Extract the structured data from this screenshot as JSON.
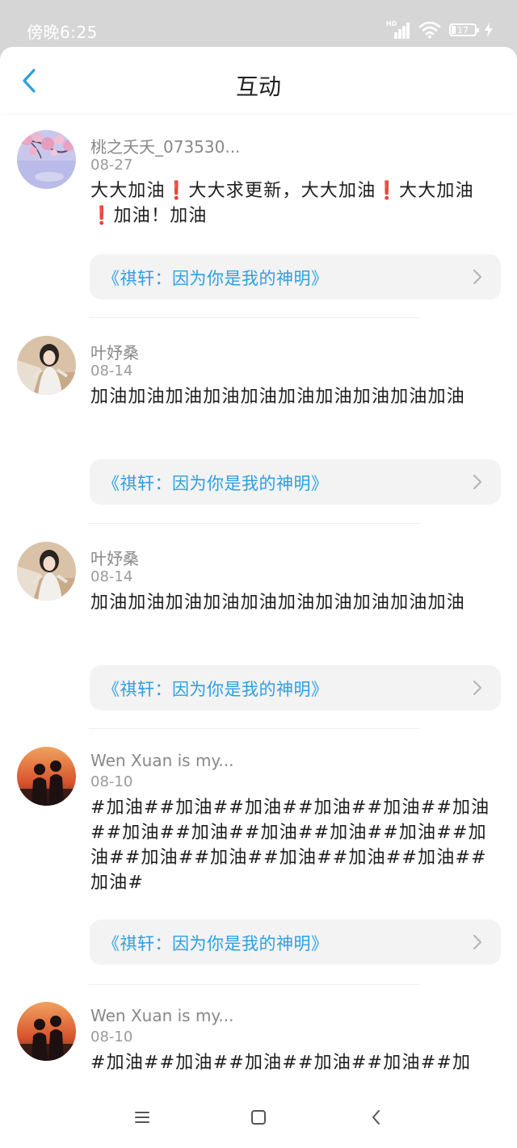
{
  "status_bar": {
    "time": "傍晚6:25",
    "network_type": "HD",
    "battery_level": "17",
    "battery_charging": true,
    "signal_icon": "signal-icon",
    "wifi_icon": "wifi-icon",
    "charging_icon": "charging-bolt-icon"
  },
  "header": {
    "title": "互动",
    "back_icon": "back-arrow-icon"
  },
  "colors": {
    "accent": "#2d9fe0",
    "exclamation": "#e62b2b",
    "status_bar_bg": "#d6d6d6",
    "card_bg": "#f3f3f3"
  },
  "posts": [
    {
      "username": "桃之夭夭_073530...",
      "date": "08-27",
      "content_parts": [
        "大大加油",
        "❗",
        "大大求更新，大大加油",
        "❗",
        "大大加油",
        "❗",
        "加油！加油"
      ],
      "book_title": "《祺轩：因为你是我的神明》",
      "avatar_icon": "avatar-blossom-image"
    },
    {
      "username": "叶妤桑",
      "date": "08-14",
      "content": "加油加油加油加油加油加油加油加油加油加油",
      "book_title": "《祺轩：因为你是我的神明》",
      "avatar_icon": "avatar-portrait-image"
    },
    {
      "username": "叶妤桑",
      "date": "08-14",
      "content": "加油加油加油加油加油加油加油加油加油加油",
      "book_title": "《祺轩：因为你是我的神明》",
      "avatar_icon": "avatar-portrait-image"
    },
    {
      "username": "Wen Xuan is my...",
      "date": "08-10",
      "content": "#加油##加油##加油##加油##加油##加油##加油##加油##加油##加油##加油##加油##加油##加油##加油##加油##加油##加油#",
      "book_title": "《祺轩：因为你是我的神明》",
      "avatar_icon": "avatar-sunset-couple-image"
    },
    {
      "username": "Wen Xuan is my...",
      "date": "08-10",
      "content": "#加油##加油##加油##加油##加油##加",
      "avatar_icon": "avatar-sunset-couple-image"
    }
  ],
  "nav_bar": {
    "menu_icon": "menu-icon",
    "home_icon": "home-square-icon",
    "back_icon": "nav-back-icon"
  }
}
